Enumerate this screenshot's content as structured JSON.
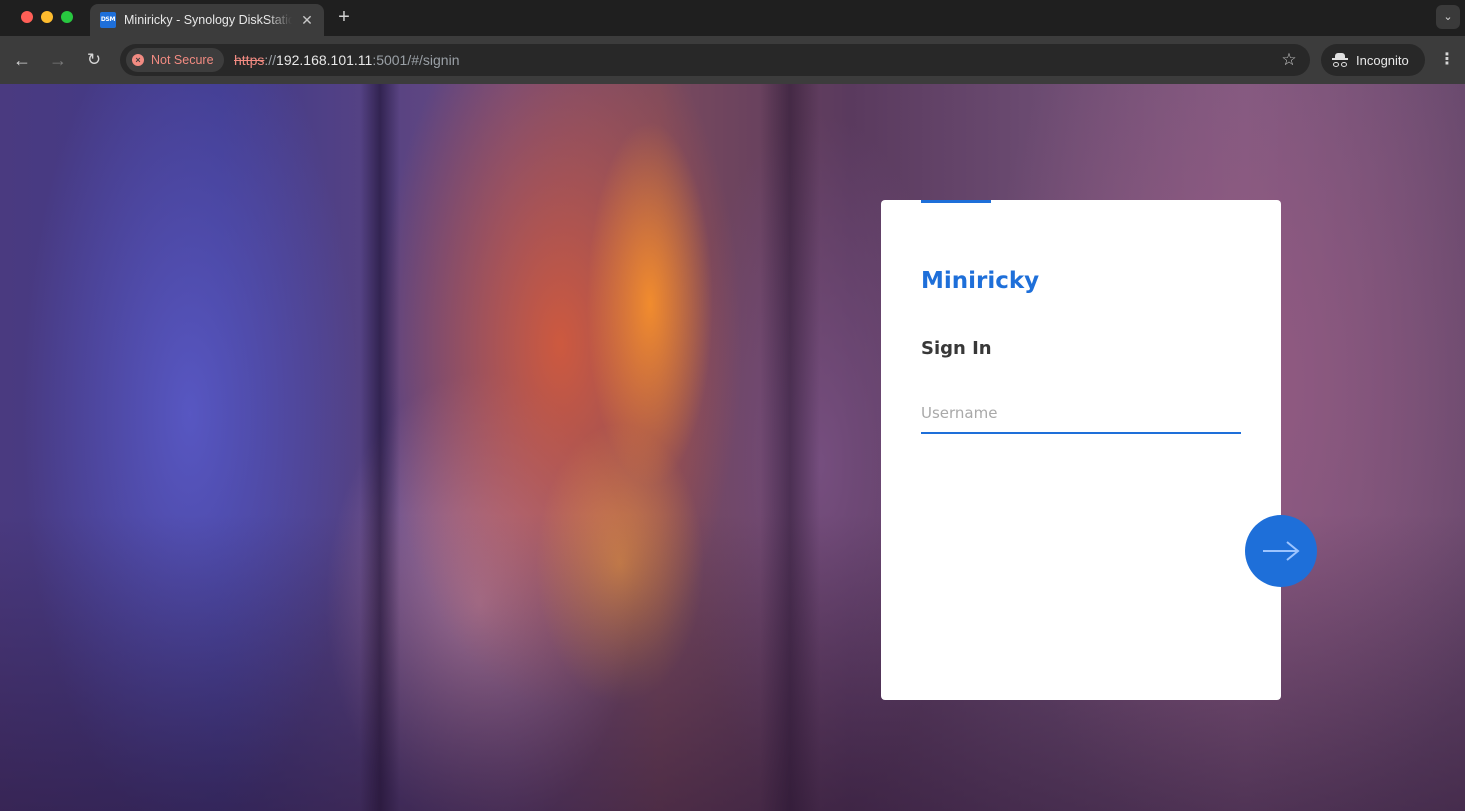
{
  "browser": {
    "tab": {
      "favicon_text": "DSM",
      "title": "Miniricky - Synology DiskStation",
      "close_glyph": "✕"
    },
    "new_tab_glyph": "+",
    "tab_search_glyph": "⌄",
    "toolbar": {
      "back_glyph": "←",
      "forward_glyph": "→",
      "reload_glyph": "↻",
      "security_label": "Not Secure",
      "url": {
        "scheme": "https",
        "separator": "://",
        "host": "192.168.101.11",
        "rest": ":5001/#/signin"
      },
      "bookmark_glyph": "☆",
      "incognito_label": "Incognito",
      "menu_glyph": "⋮"
    }
  },
  "signin": {
    "host_name": "Miniricky",
    "title": "Sign In",
    "username_placeholder": "Username",
    "username_value": ""
  },
  "colors": {
    "accent": "#1e6fd9",
    "warning": "#f28b82"
  }
}
